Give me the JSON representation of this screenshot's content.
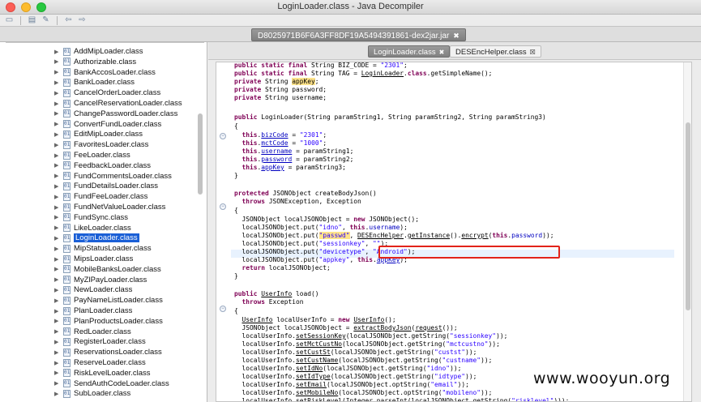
{
  "window": {
    "title": "LoginLoader.class - Java Decompiler"
  },
  "toolbar": {
    "buttons": [
      {
        "name": "open-file-icon",
        "glyph": "▭"
      },
      {
        "name": "open-type-icon",
        "glyph": "▤"
      },
      {
        "name": "search-icon",
        "glyph": "✎"
      },
      {
        "name": "back-icon",
        "glyph": "⇦"
      },
      {
        "name": "forward-icon",
        "glyph": "⇨"
      }
    ]
  },
  "file_tab": {
    "label": "D8025971B6F6A3FF8DF19A5494391861-dex2jar.jar",
    "close": "✖"
  },
  "sidebar": {
    "items": [
      "AddMipLoader.class",
      "Authorizable.class",
      "BankAccosLoader.class",
      "BankLoader.class",
      "CancelOrderLoader.class",
      "CancelReservationLoader.class",
      "ChangePasswordLoader.class",
      "ConvertFundLoader.class",
      "EditMipLoader.class",
      "FavoritesLoader.class",
      "FeeLoader.class",
      "FeedbackLoader.class",
      "FundCommentsLoader.class",
      "FundDetailsLoader.class",
      "FundFeeLoader.class",
      "FundNetValueLoader.class",
      "FundSync.class",
      "LikeLoader.class",
      "LoginLoader.class",
      "MipStatusLoader.class",
      "MipsLoader.class",
      "MobileBanksLoader.class",
      "MyZlPayLoader.class",
      "NewLoader.class",
      "PayNameListLoader.class",
      "PlanLoader.class",
      "PlanProductsLoader.class",
      "RedLoader.class",
      "RegisterLoader.class",
      "ReservationsLoader.class",
      "ReserveLoader.class",
      "RiskLevelLoader.class",
      "SendAuthCodeLoader.class",
      "SubLoader.class"
    ],
    "selected_index": 18
  },
  "editor": {
    "tabs": [
      {
        "label": "LoginLoader.class",
        "close": "✖",
        "active": true
      },
      {
        "label": "DESEncHelper.class",
        "close": "☒",
        "active": false
      }
    ]
  },
  "watermark": "www.wooyun.org"
}
